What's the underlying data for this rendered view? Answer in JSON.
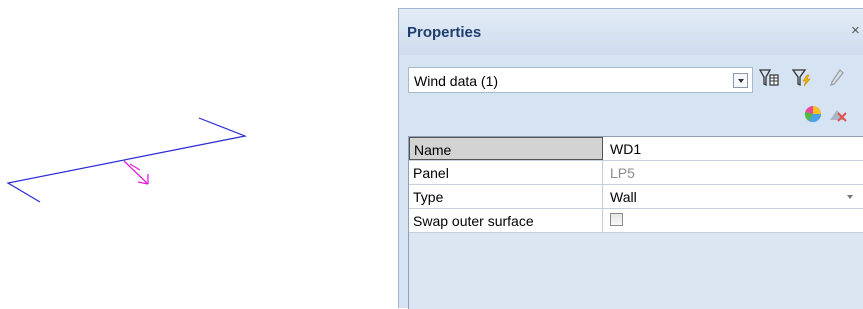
{
  "panel": {
    "title": "Properties",
    "close_glyph": "×",
    "selector_value": "Wind data (1)",
    "toolbar_icons": [
      "filter-table-icon",
      "filter-lightning-icon",
      "pencil-icon",
      "pie-chart-icon",
      "clear-icon"
    ]
  },
  "properties": {
    "rows": [
      {
        "name": "Name",
        "value": "WD1"
      },
      {
        "name": "Panel",
        "value": "LP5"
      },
      {
        "name": "Type",
        "value": "Wall"
      },
      {
        "name": "Swap outer surface",
        "value": "",
        "checked": false
      }
    ]
  },
  "colors": {
    "wall_line": "#2b2bd6",
    "wind_arrow": "#e020e0",
    "panel_bg": "#d6e3f2",
    "title_text": "#1e3f6e"
  }
}
